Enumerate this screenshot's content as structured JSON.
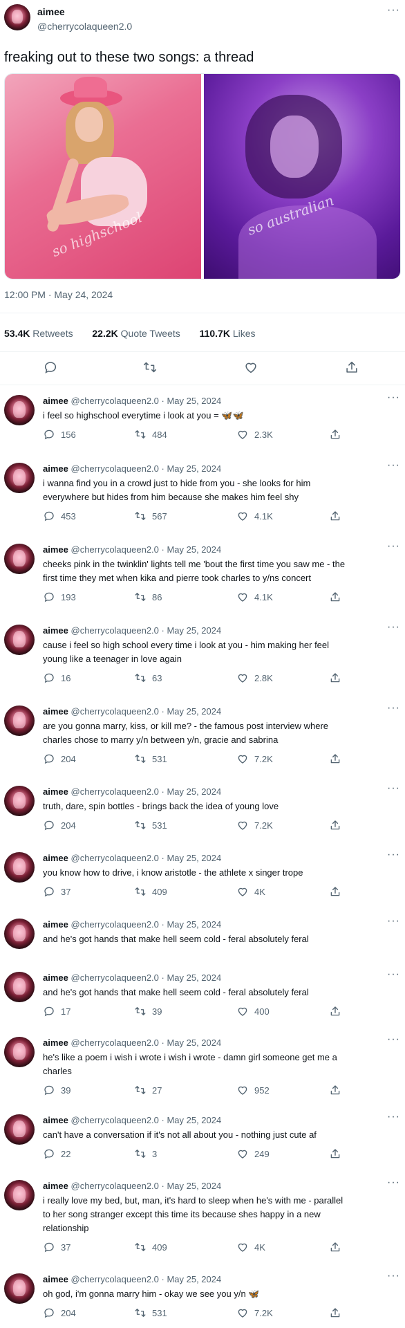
{
  "author": {
    "name": "aimee",
    "handle": "@cherrycolaqueen2.0"
  },
  "main": {
    "text": "freaking out to these two songs: a thread",
    "images": [
      {
        "watermark": "so highschool"
      },
      {
        "watermark": "so australian"
      }
    ],
    "timestamp": "12:00 PM · May 24, 2024",
    "stats": {
      "retweets_num": "53.4K",
      "retweets_label": "Retweets",
      "quotes_num": "22.2K",
      "quotes_label": "Quote Tweets",
      "likes_num": "110.7K",
      "likes_label": "Likes"
    }
  },
  "replies": [
    {
      "name": "aimee",
      "handle": "@cherrycolaqueen2.0",
      "date": "· May 25, 2024",
      "lines": [
        "i feel so highschool everytime i look at you = 🦋🦋"
      ],
      "replies": "156",
      "retweets": "484",
      "likes": "2.3K",
      "show_actions": true
    },
    {
      "name": "aimee",
      "handle": "@cherrycolaqueen2.0",
      "date": "· May 25, 2024",
      "lines": [
        "i wanna find you in a crowd just to hide from you - she looks for him",
        "everywhere but hides from him because she makes him feel shy"
      ],
      "replies": "453",
      "retweets": "567",
      "likes": "4.1K",
      "show_actions": true
    },
    {
      "name": "aimee",
      "handle": "@cherrycolaqueen2.0",
      "date": "· May 25, 2024",
      "lines": [
        "cheeks pink in the twinklin' lights tell me 'bout the first time you saw me - the",
        "first time they met when kika and pierre took charles to y/ns concert"
      ],
      "replies": "193",
      "retweets": "86",
      "likes": "4.1K",
      "show_actions": true
    },
    {
      "name": "aimee",
      "handle": "@cherrycolaqueen2.0",
      "date": "· May 25, 2024",
      "lines": [
        "cause i feel so high school every time i look at you - him making her feel",
        "young like a teenager in love again"
      ],
      "replies": "16",
      "retweets": "63",
      "likes": "2.8K",
      "show_actions": true
    },
    {
      "name": "aimee",
      "handle": "@cherrycolaqueen2.0",
      "date": "· May 25, 2024",
      "lines": [
        "are you gonna marry, kiss, or kill me? - the famous post interview where",
        "charles chose to marry y/n between y/n, gracie and sabrina"
      ],
      "replies": "204",
      "retweets": "531",
      "likes": "7.2K",
      "show_actions": true
    },
    {
      "name": "aimee",
      "handle": "@cherrycolaqueen2.0",
      "date": "· May 25, 2024",
      "lines": [
        "truth, dare, spin bottles - brings back the idea of young love"
      ],
      "replies": "204",
      "retweets": "531",
      "likes": "7.2K",
      "show_actions": true
    },
    {
      "name": "aimee",
      "handle": "@cherrycolaqueen2.0",
      "date": "· May 25, 2024",
      "lines": [
        "you know how to drive, i know aristotle - the athlete x singer trope"
      ],
      "replies": "37",
      "retweets": "409",
      "likes": "4K",
      "show_actions": true
    },
    {
      "name": "aimee",
      "handle": "@cherrycolaqueen2.0",
      "date": "· May 25, 2024",
      "lines": [
        "and he's got hands that make hell seem cold - feral absolutely feral"
      ],
      "replies": "",
      "retweets": "",
      "likes": "",
      "show_actions": false
    },
    {
      "name": "aimee",
      "handle": "@cherrycolaqueen2.0",
      "date": "· May 25, 2024",
      "lines": [
        "and he's got hands that make hell seem cold - feral absolutely feral"
      ],
      "replies": "17",
      "retweets": "39",
      "likes": "400",
      "show_actions": true
    },
    {
      "name": "aimee",
      "handle": "@cherrycolaqueen2.0",
      "date": "· May 25, 2024",
      "lines": [
        "he's like a poem i wish i wrote i wish i wrote - damn girl someone get me a",
        "charles"
      ],
      "replies": "39",
      "retweets": "27",
      "likes": "952",
      "show_actions": true
    },
    {
      "name": "aimee",
      "handle": "@cherrycolaqueen2.0",
      "date": "· May 25, 2024",
      "lines": [
        "can't have a conversation if it's not all about you - nothing just cute af"
      ],
      "replies": "22",
      "retweets": "3",
      "likes": "249",
      "show_actions": true
    },
    {
      "name": "aimee",
      "handle": "@cherrycolaqueen2.0",
      "date": "· May 25, 2024",
      "lines": [
        "i really love my bed, but, man, it's hard to sleep when he's with me - parallel",
        "to her song stranger except this time its because shes happy in a new",
        "relationship"
      ],
      "replies": "37",
      "retweets": "409",
      "likes": "4K",
      "show_actions": true
    },
    {
      "name": "aimee",
      "handle": "@cherrycolaqueen2.0",
      "date": "· May 25, 2024",
      "lines": [
        "oh god, i'm gonna marry him - okay we see you y/n 🦋"
      ],
      "replies": "204",
      "retweets": "531",
      "likes": "7.2K",
      "show_actions": true
    }
  ],
  "icons": {
    "more": "more-dots-icon",
    "reply": "reply-icon",
    "retweet": "retweet-icon",
    "like": "heart-icon",
    "share": "share-icon"
  },
  "colors": {
    "text": "#0f1419",
    "muted": "#536471",
    "divider": "#eff3f4",
    "butterfly": "#c0394d"
  }
}
